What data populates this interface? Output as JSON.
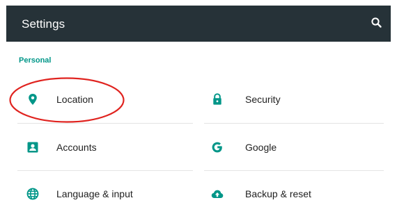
{
  "appbar": {
    "title": "Settings",
    "search_icon": "search-icon",
    "background": "#263238"
  },
  "section": {
    "title": "Personal",
    "color": "#009688"
  },
  "items": [
    {
      "label": "Location",
      "icon": "location-pin-icon"
    },
    {
      "label": "Security",
      "icon": "lock-icon"
    },
    {
      "label": "Accounts",
      "icon": "account-box-icon"
    },
    {
      "label": "Google",
      "icon": "google-icon"
    },
    {
      "label": "Language & input",
      "icon": "globe-icon"
    },
    {
      "label": "Backup & reset",
      "icon": "cloud-upload-icon"
    }
  ],
  "annotation": {
    "shape": "ellipse",
    "color": "#e0231f",
    "target": "Location"
  },
  "icon_color": "#009688"
}
